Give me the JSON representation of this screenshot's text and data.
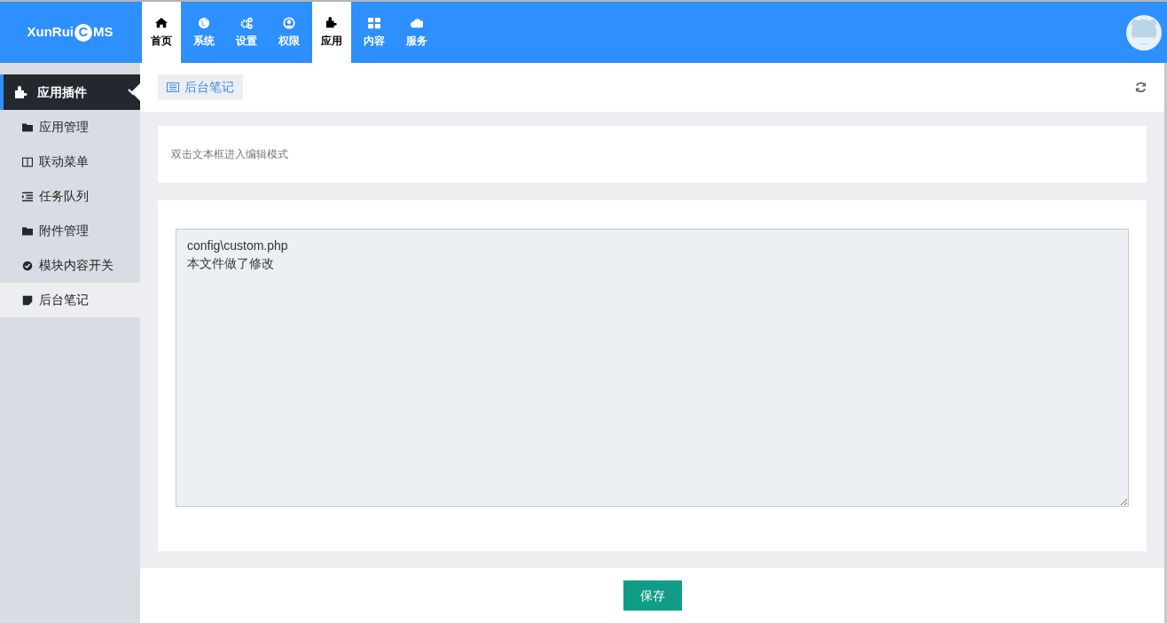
{
  "logo": {
    "before": "XunRui",
    "mark": "C",
    "after": "MS"
  },
  "nav": [
    {
      "label": "首页",
      "selected": true
    },
    {
      "label": "系统",
      "selected": false
    },
    {
      "label": "设置",
      "selected": false
    },
    {
      "label": "权限",
      "selected": false
    },
    {
      "label": "应用",
      "selected": true
    },
    {
      "label": "内容",
      "selected": false
    },
    {
      "label": "服务",
      "selected": false
    }
  ],
  "sidebar": {
    "title": "应用插件",
    "expanded": true,
    "items": [
      {
        "label": "应用管理",
        "selected": false
      },
      {
        "label": "联动菜单",
        "selected": false
      },
      {
        "label": "任务队列",
        "selected": false
      },
      {
        "label": "附件管理",
        "selected": false
      },
      {
        "label": "模块内容开关",
        "selected": false
      },
      {
        "label": "后台笔记",
        "selected": true
      }
    ]
  },
  "page_tab": {
    "label": "后台笔记"
  },
  "hint": "双击文本框进入编辑模式",
  "note": {
    "value": "config\\custom.php\n本文件做了修改"
  },
  "save_button": "保存"
}
